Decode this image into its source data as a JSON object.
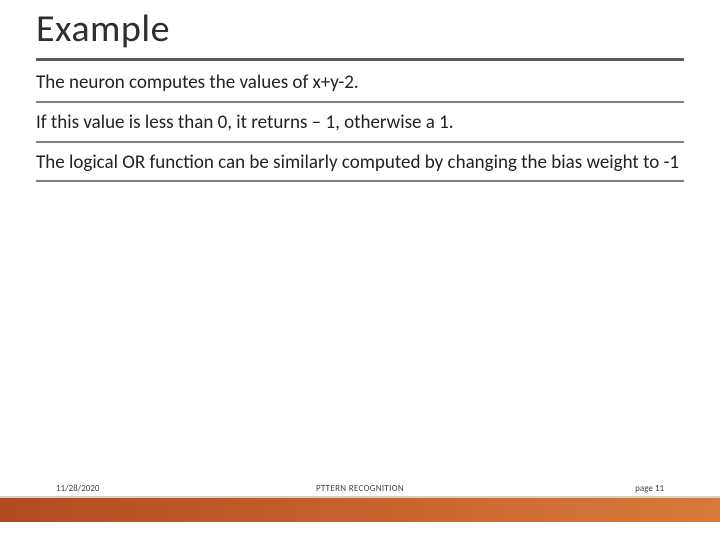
{
  "slide": {
    "title": "Example",
    "paragraphs": [
      "The neuron computes the values of x+y-2.",
      "If this value is less than 0, it returns – 1, otherwise a 1.",
      "The logical OR function can be similarly computed by changing the bias weight to -1"
    ],
    "footer": {
      "date": "11/28/2020",
      "center": "PTTERN RECOGNITION",
      "page_label": "page 11"
    }
  }
}
